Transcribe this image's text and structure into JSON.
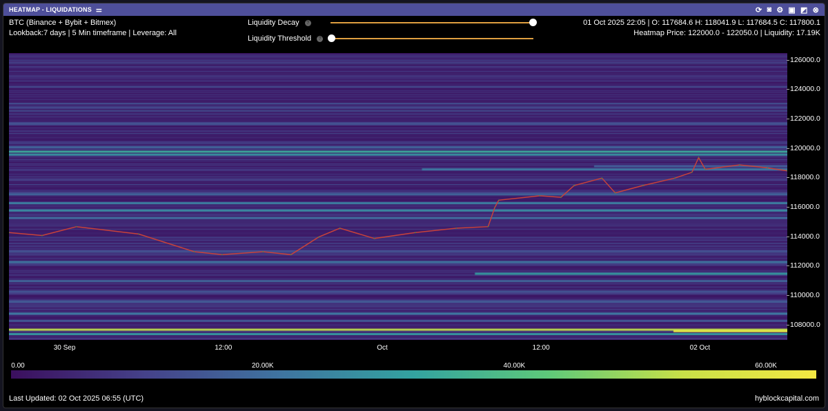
{
  "window": {
    "title": "HEATMAP - LIQUIDATIONS",
    "icons": [
      "refresh-icon",
      "camera-icon",
      "gear-icon",
      "save-icon",
      "expand-icon",
      "close-icon"
    ]
  },
  "info": {
    "symbol": "BTC (Binance + Bybit + Bitmex)",
    "lookback": "Lookback:7 days | 5 Min timeframe | Leverage: All",
    "ohlc": "01 Oct 2025 22:05 | O: 117684.6 H: 118041.9 L: 117684.5 C: 117800.1",
    "heatmap_price": "Heatmap Price: 122000.0 - 122050.0 | Liquidity: 17.19K"
  },
  "controls": {
    "decay_label": "Liquidity Decay",
    "threshold_label": "Liquidity Threshold",
    "decay_value": 1.0,
    "threshold_value": 0.0,
    "help": "?"
  },
  "footer": {
    "updated": "Last Updated: 02 Oct 2025 06:55 (UTC)",
    "brand": "hyblockcapital.com"
  },
  "chart_data": {
    "type": "heatmap",
    "ylim": [
      107000,
      126500
    ],
    "xlim_hours": [
      -4.2,
      54.6
    ],
    "yticks": [
      "126000.0",
      "124000.0",
      "122000.0",
      "120000.0",
      "118000.0",
      "116000.0",
      "114000.0",
      "112000.0",
      "110000.0",
      "108000.0"
    ],
    "ytick_values": [
      126000,
      124000,
      122000,
      120000,
      118000,
      116000,
      114000,
      112000,
      110000,
      108000
    ],
    "xticks": [
      {
        "label": "30 Sep",
        "h": 0
      },
      {
        "label": "12:00",
        "h": 12
      },
      {
        "label": "Oct",
        "h": 24
      },
      {
        "label": "12:00",
        "h": 36
      },
      {
        "label": "02 Oct",
        "h": 48
      }
    ],
    "colorbar": {
      "labels": [
        "0.00",
        "20.00K",
        "40.00K",
        "60.00K"
      ],
      "values": [
        0,
        20000,
        40000,
        60000
      ],
      "max": 64000,
      "colors": [
        "#3b0f5e",
        "#45428a",
        "#3f74a0",
        "#33a3a0",
        "#5ec97a",
        "#c8e048",
        "#f4e842"
      ]
    },
    "bands": [
      [
        119800,
        34000,
        -4.2
      ],
      [
        119600,
        28000,
        -4.2
      ],
      [
        120100,
        18000,
        -4.2
      ],
      [
        116300,
        24000,
        -4.2
      ],
      [
        115800,
        26000,
        -4.2
      ],
      [
        115300,
        20000,
        -4.2
      ],
      [
        116900,
        18000,
        -4.2
      ],
      [
        118600,
        22000,
        27
      ],
      [
        118800,
        16000,
        40
      ],
      [
        112300,
        22000,
        -4.2
      ],
      [
        111500,
        30000,
        31
      ],
      [
        111000,
        18000,
        -4.2
      ],
      [
        109600,
        16000,
        -4.2
      ],
      [
        108800,
        22000,
        -4.2
      ],
      [
        107700,
        52000,
        -4.2
      ],
      [
        107400,
        30000,
        -4.2
      ],
      [
        113000,
        14000,
        -4.2
      ],
      [
        108300,
        16000,
        -4.2
      ],
      [
        122800,
        12000,
        -4.2
      ],
      [
        121700,
        14000,
        -4.2
      ],
      [
        110300,
        14000,
        -4.2
      ],
      [
        107600,
        60000,
        46
      ]
    ],
    "price_series": {
      "name": "BTC",
      "hours": [
        -4.2,
        -1.7,
        0.9,
        5.6,
        9.8,
        11.9,
        15,
        17.1,
        19.2,
        20.8,
        23.4,
        26.5,
        29.6,
        32,
        32.5,
        32.8,
        35.9,
        37.5,
        38.5,
        40.6,
        41.6,
        43.7,
        46.1,
        47.4,
        47.9,
        48.4,
        51,
        53.1,
        54.6
      ],
      "values": [
        114300,
        114100,
        114700,
        114200,
        113000,
        112800,
        113000,
        112800,
        114000,
        114600,
        113900,
        114300,
        114600,
        114700,
        116000,
        116500,
        116800,
        116700,
        117500,
        118000,
        117000,
        117500,
        118000,
        118400,
        119400,
        118600,
        118900,
        118700,
        118500
      ]
    }
  }
}
